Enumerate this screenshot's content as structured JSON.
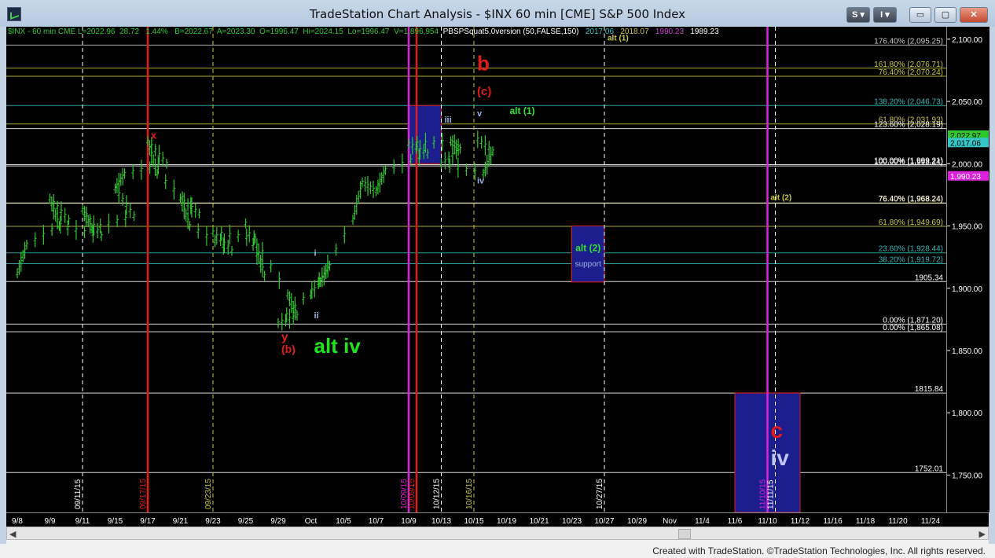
{
  "window": {
    "title": "TradeStation Chart Analysis - $INX 60 min [CME] S&P 500 Index",
    "buttons": {
      "s_label": "S ▾",
      "i_label": "I ▾",
      "min": "▭",
      "max": "▢",
      "close": "✕"
    }
  },
  "info": {
    "symbol": "$INX - 60 min  CME",
    "last": "L=2022.96",
    "change": "28.72",
    "pct": "1.44%",
    "bid": "B=2022.67",
    "ask": "A=2023.30",
    "open": "O=1996.47",
    "high": "Hi=2024.15",
    "low": "Lo=1996.47",
    "volume": "V=1,896,954",
    "indicator": "PBSPSquat5.0version (50,FALSE,150)",
    "ind_values": [
      {
        "text": "2017.06",
        "color": "#34c6c6"
      },
      {
        "text": "2018.07",
        "color": "#c8c840"
      },
      {
        "text": "1990.23",
        "color": "#d040d0"
      },
      {
        "text": "1989.23",
        "color": "#ffffff"
      }
    ]
  },
  "status": {
    "credit": "Created with TradeStation. ©TradeStation Technologies, Inc. All rights reserved."
  },
  "colors": {
    "candle": "#2ec82e",
    "wave_red": "#e31b1b",
    "wave_green": "#1ee61e",
    "magenta": "#dd22dd",
    "navy_box": "#1b1e8c"
  },
  "chart_data": {
    "type": "bar",
    "title": "",
    "ylim": [
      1720,
      2110
    ],
    "y_ticks": [
      "2,100.00",
      "2,050.00",
      "2,000.00",
      "1,950.00",
      "1,900.00",
      "1,850.00",
      "1,800.00",
      "1,750.00"
    ],
    "y_tick_values": [
      2100,
      2050,
      2000,
      1950,
      1900,
      1850,
      1800,
      1750
    ],
    "x_labels": [
      "9/8",
      "9/9",
      "9/11",
      "9/15",
      "9/17",
      "9/21",
      "9/23",
      "9/25",
      "9/29",
      "Oct",
      "10/5",
      "10/7",
      "10/9",
      "10/13",
      "10/15",
      "10/19",
      "10/21",
      "10/23",
      "10/27",
      "10/29",
      "Nov",
      "11/4",
      "11/6",
      "11/10",
      "11/12",
      "11/16",
      "11/18",
      "11/20",
      "11/24"
    ],
    "price_path": [
      [
        "9/8",
        1912
      ],
      [
        "9/8",
        1935
      ],
      [
        "9/9",
        1955
      ],
      [
        "9/9",
        1972
      ],
      [
        "9/9",
        1950
      ],
      [
        "9/11",
        1942
      ],
      [
        "9/11",
        1963
      ],
      [
        "9/11",
        1948
      ],
      [
        "9/15",
        1958
      ],
      [
        "9/15",
        1980
      ],
      [
        "9/15",
        1992
      ],
      [
        "9/17",
        2000
      ],
      [
        "9/17",
        2018
      ],
      [
        "9/17",
        1992
      ],
      [
        "9/21",
        1960
      ],
      [
        "9/21",
        1972
      ],
      [
        "9/21",
        1950
      ],
      [
        "9/23",
        1930
      ],
      [
        "9/23",
        1945
      ],
      [
        "9/25",
        1940
      ],
      [
        "9/25",
        1910
      ],
      [
        "9/25",
        1952
      ],
      [
        "9/29",
        1895
      ],
      [
        "9/29",
        1878
      ],
      [
        "9/29",
        1872
      ],
      [
        "Oct",
        1905
      ],
      [
        "Oct",
        1918
      ],
      [
        "Oct",
        1895
      ],
      [
        "10/5",
        1955
      ],
      [
        "10/5",
        1985
      ],
      [
        "10/7",
        1978
      ],
      [
        "10/7",
        1995
      ],
      [
        "10/9",
        2008
      ],
      [
        "10/9",
        2016
      ],
      [
        "10/13",
        2018
      ],
      [
        "10/13",
        2012
      ],
      [
        "10/13",
        2000
      ],
      [
        "10/15",
        1992
      ],
      [
        "10/15",
        2010
      ],
      [
        "10/15",
        2022
      ]
    ],
    "vertical_lines": [
      {
        "label": "09/11/15",
        "date": "9/11",
        "style": "dashed",
        "color": "#ffffff"
      },
      {
        "label": "09/17/15",
        "date": "9/17",
        "style": "solid",
        "color": "#e31b1b"
      },
      {
        "label": "09/23/15",
        "date": "9/23",
        "style": "dashed",
        "color": "#c8c840"
      },
      {
        "label": "10/09/15",
        "date": "10/9",
        "style": "solid",
        "color": "#dd22dd"
      },
      {
        "label": "10/09/15",
        "date": "10/9",
        "style": "solid",
        "color": "#e31b1b"
      },
      {
        "label": "10/12/15",
        "date": "10/13",
        "style": "dashed",
        "color": "#ffffff"
      },
      {
        "label": "10/16/15",
        "date": "10/15",
        "style": "dashed",
        "color": "#c8c840"
      },
      {
        "label": "10/27/15",
        "date": "10/27",
        "style": "dashed",
        "color": "#ffffff"
      },
      {
        "label": "11/10/15",
        "date": "11/10",
        "style": "solid",
        "color": "#dd22dd"
      },
      {
        "label": "11/11/15",
        "date": "11/10",
        "style": "dashed",
        "color": "#ffffff"
      }
    ],
    "fib_levels": [
      {
        "label": "176.40% (2,095.25)",
        "value": 2095.25,
        "color": "#c8c8c8"
      },
      {
        "label": "161.80% (2,076.71)",
        "value": 2076.71,
        "color": "#c8c840"
      },
      {
        "label": "76.40% (2,070.24)",
        "value": 2070.24,
        "color": "#c8c840"
      },
      {
        "label": "138.20% (2,046.73)",
        "value": 2046.73,
        "color": "#34b6b6"
      },
      {
        "label": "61.80% (2,031.93)",
        "value": 2031.93,
        "color": "#c8c840"
      },
      {
        "label": "123.60% (2,028.19)",
        "value": 2028.19,
        "color": "#ffffff"
      },
      {
        "label": "100.00% (1,998.24)",
        "value": 1998.24,
        "color": "#ffffff"
      },
      {
        "label": "100.00% (1,999.21)",
        "value": 1999.21,
        "color": "#ffffff"
      },
      {
        "label": "76.40% (1,968.24)",
        "value": 1968.24,
        "color": "#c8c840"
      },
      {
        "label": "76.40% (1,968.24)",
        "value": 1968.5,
        "color": "#ffffff"
      },
      {
        "label": "61.80% (1,949.69)",
        "value": 1949.69,
        "color": "#c8c840"
      },
      {
        "label": "23.60% (1,928.44)",
        "value": 1928.44,
        "color": "#34b6b6"
      },
      {
        "label": "38.20% (1,919.72)",
        "value": 1919.72,
        "color": "#34b6b6"
      },
      {
        "label": "1905.34",
        "value": 1905.34,
        "color": "#ffffff"
      },
      {
        "label": "0.00% (1,871.20)",
        "value": 1871.2,
        "color": "#ffffff"
      },
      {
        "label": "0.00% (1,865.08)",
        "value": 1865.08,
        "color": "#ffffff"
      },
      {
        "label": "1815.84",
        "value": 1815.84,
        "color": "#ffffff"
      },
      {
        "label": "1752.01",
        "value": 1752.01,
        "color": "#ffffff"
      }
    ],
    "price_tags": [
      {
        "text": "2,022.97",
        "value": 2022.97,
        "bg": "#2ec82e",
        "fg": "#000000"
      },
      {
        "text": "2,017.06",
        "value": 2017.06,
        "bg": "#34c6c6",
        "fg": "#000000"
      },
      {
        "text": "1,990.23",
        "value": 1990.23,
        "bg": "#dd22dd",
        "fg": "#ffffff"
      }
    ],
    "annotations": [
      {
        "text": "x",
        "date": "9/17",
        "value": 2020,
        "color": "#e31b1b",
        "size": 13
      },
      {
        "text": "b",
        "date": "10/15",
        "value": 2075,
        "color": "#e31b1b",
        "size": 26
      },
      {
        "text": "(c)",
        "date": "10/15",
        "value": 2055,
        "color": "#e31b1b",
        "size": 15
      },
      {
        "text": "alt (1)",
        "date": "10/19",
        "value": 2040,
        "color": "#2ee62e",
        "size": 12
      },
      {
        "text": "v",
        "date": "10/15",
        "value": 2038,
        "color": "#9cb4e6",
        "size": 11
      },
      {
        "text": "iii",
        "date": "10/13",
        "value": 2033,
        "color": "#9cb4e6",
        "size": 11
      },
      {
        "text": "iv",
        "date": "10/15",
        "value": 1984,
        "color": "#9cb4e6",
        "size": 11
      },
      {
        "text": "alt (1)",
        "date": "10/27",
        "value": 2099,
        "color": "#c8c840",
        "size": 10
      },
      {
        "text": "alt (2)",
        "date": "11/10",
        "value": 1971,
        "color": "#c8c840",
        "size": 10
      },
      {
        "text": "i",
        "date": "Oct",
        "value": 1926,
        "color": "#9cb4e6",
        "size": 11
      },
      {
        "text": "ii",
        "date": "Oct",
        "value": 1876,
        "color": "#9cb4e6",
        "size": 11
      },
      {
        "text": "y",
        "date": "9/29",
        "value": 1858,
        "color": "#e31b1b",
        "size": 15
      },
      {
        "text": "(b)",
        "date": "9/29",
        "value": 1848,
        "color": "#e31b1b",
        "size": 14
      },
      {
        "text": "alt iv",
        "date": "Oct",
        "value": 1848,
        "color": "#1ee61e",
        "size": 26
      },
      {
        "text": "c",
        "date": "11/10",
        "value": 1780,
        "color": "#e31b1b",
        "size": 28
      },
      {
        "text": "iv",
        "date": "11/10",
        "value": 1758,
        "color": "#c0c8ff",
        "size": 28
      }
    ],
    "target_boxes": [
      {
        "name": "alt-2-support-box",
        "x_from": "10/23",
        "x_to": "10/27",
        "top": 1950,
        "bottom": 1905,
        "title": "alt (2)",
        "subtitle": "support"
      },
      {
        "name": "c-iv-target-box",
        "x_from": "11/6",
        "x_to": "11/12",
        "top": 1815.84,
        "bottom": 1720,
        "title": "",
        "subtitle": ""
      },
      {
        "name": "b-wave-box",
        "x_from": "10/9",
        "x_to": "10/13",
        "top": 2046.73,
        "bottom": 2000,
        "title": "",
        "subtitle": ""
      }
    ]
  }
}
